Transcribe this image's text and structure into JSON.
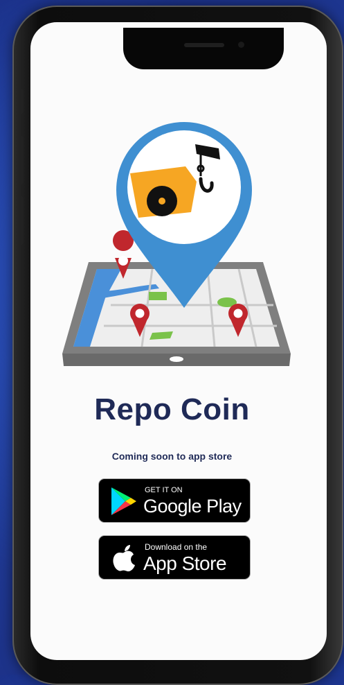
{
  "app": {
    "title": "Repo Coin",
    "tagline": "Coming soon to app store"
  },
  "stores": {
    "google": {
      "small": "GET IT ON",
      "big": "Google Play",
      "icon": "google-play-icon"
    },
    "apple": {
      "small": "Download on the",
      "big": "App Store",
      "icon": "apple-icon"
    }
  },
  "colors": {
    "background": "#1f3a9c",
    "title": "#1f2a57",
    "pin_blue": "#3f8fd1",
    "marker_red": "#c0272d",
    "truck_orange": "#f6a623"
  }
}
